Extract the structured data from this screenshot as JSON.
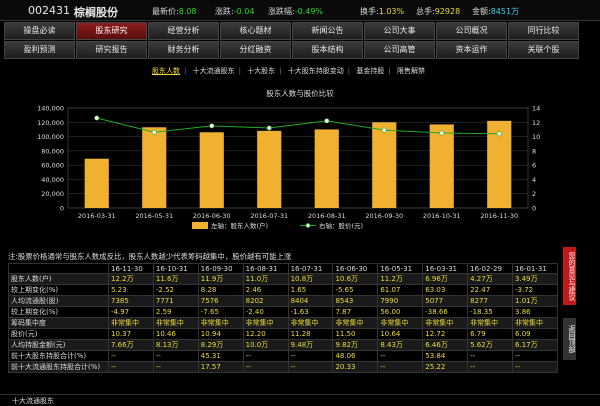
{
  "header": {
    "code": "002431",
    "name": "棕榈股份",
    "quotes": [
      {
        "label": "最新价:",
        "value": "8.08",
        "cls": "g"
      },
      {
        "label": "涨跌:",
        "value": "-0.04",
        "cls": "g"
      },
      {
        "label": "涨跌幅:",
        "value": "-0.49%",
        "cls": "g"
      },
      {
        "label": "换手:",
        "value": "1.03%",
        "cls": "y"
      },
      {
        "label": "总手:",
        "value": "92928",
        "cls": "y"
      },
      {
        "label": "金额:",
        "value": "8451万",
        "cls": "c"
      }
    ]
  },
  "nav": {
    "row1": [
      "操盘必读",
      "股东研究",
      "经营分析",
      "核心题材",
      "新闻公告",
      "公司大事",
      "公司概况",
      "同行比较"
    ],
    "row2": [
      "盈利预测",
      "研究报告",
      "财务分析",
      "分红融资",
      "股本结构",
      "公司高管",
      "资本运作",
      "关联个股"
    ],
    "active": "股东研究"
  },
  "subtabs": [
    "股东人数",
    "十大流通股东",
    "十大股东",
    "十大股东持股变动",
    "基金持股",
    "限售解禁"
  ],
  "chart_data": {
    "type": "bar+line",
    "title": "股东人数与股价比较",
    "categories": [
      "2016-03-31",
      "2016-05-31",
      "2016-06-30",
      "2016-07-31",
      "2016-08-31",
      "2016-09-30",
      "2016-10-31",
      "2016-11-30"
    ],
    "series": [
      {
        "name": "左轴：股东人数(户)",
        "type": "bar",
        "color": "#f0b030",
        "values": [
          69000,
          113000,
          106000,
          108000,
          110000,
          120000,
          117000,
          122000
        ]
      },
      {
        "name": "右轴：股价(元)",
        "type": "line",
        "color": "#22aa22",
        "values": [
          12.6,
          10.6,
          11.5,
          11.2,
          12.2,
          10.9,
          10.5,
          10.4
        ]
      }
    ],
    "y_left": {
      "min": 0,
      "max": 140000,
      "ticks": [
        "0",
        "20,000",
        "40,000",
        "60,000",
        "80,000",
        "100,000",
        "120,000",
        "140,000"
      ]
    },
    "y_right": {
      "min": 0,
      "max": 14,
      "ticks": [
        "0",
        "2",
        "4",
        "6",
        "8",
        "10",
        "12",
        "14"
      ]
    }
  },
  "note": "注:股票价格通常与股东人数成反比，股东人数越少代表筹码越集中，股价越有可能上涨",
  "table": {
    "dates": [
      "16-11-30",
      "16-10-31",
      "16-09-30",
      "16-08-31",
      "16-07-31",
      "16-06-30",
      "16-05-31",
      "16-03-31",
      "16-02-29",
      "16-01-31"
    ],
    "rows": [
      {
        "label": "股东人数(户)",
        "values": [
          "12.2万",
          "11.6万",
          "11.9万",
          "11.0万",
          "10.8万",
          "10.6万",
          "11.2万",
          "6.96万",
          "4.27万",
          "3.49万"
        ]
      },
      {
        "label": "较上期变化(%)",
        "values": [
          "5.23",
          "-2.52",
          "8.28",
          "2.46",
          "1.65",
          "-5.65",
          "61.07",
          "63.03",
          "22.47",
          "-3.72"
        ]
      },
      {
        "label": "人均流通股(股)",
        "values": [
          "7385",
          "7771",
          "7576",
          "8202",
          "8404",
          "8543",
          "7990",
          "5077",
          "8277",
          "1.01万"
        ]
      },
      {
        "label": "较上期变化(%)",
        "values": [
          "-4.97",
          "2.59",
          "-7.65",
          "-2.40",
          "-1.63",
          "7.87",
          "56.00",
          "-38.66",
          "-18.35",
          "3.86"
        ]
      },
      {
        "label": "筹码集中度",
        "values": [
          "非常集中",
          "非常集中",
          "非常集中",
          "非常集中",
          "非常集中",
          "非常集中",
          "非常集中",
          "非常集中",
          "非常集中",
          "非常集中"
        ]
      },
      {
        "label": "股价(元)",
        "values": [
          "10.37",
          "10.46",
          "10.94",
          "12.20",
          "11.28",
          "11.50",
          "10.64",
          "12.72",
          "6.79",
          "6.09"
        ]
      },
      {
        "label": "人均持股金额(元)",
        "values": [
          "7.66万",
          "8.13万",
          "8.29万",
          "10.0万",
          "9.48万",
          "9.82万",
          "8.43万",
          "6.46万",
          "5.62万",
          "6.17万"
        ]
      },
      {
        "label": "前十大股东持股合计(%)",
        "values": [
          "--",
          "--",
          "45.31",
          "--",
          "--",
          "48.06",
          "--",
          "53.84",
          "--",
          "--"
        ]
      },
      {
        "label": "前十大流通股东持股合计(%)",
        "values": [
          "--",
          "--",
          "17.57",
          "--",
          "--",
          "20.33",
          "--",
          "25.22",
          "--",
          "--"
        ]
      }
    ]
  },
  "side": {
    "feedback": "您的意见与建议",
    "back": "返回顶部"
  },
  "footer": "十大流通股东"
}
